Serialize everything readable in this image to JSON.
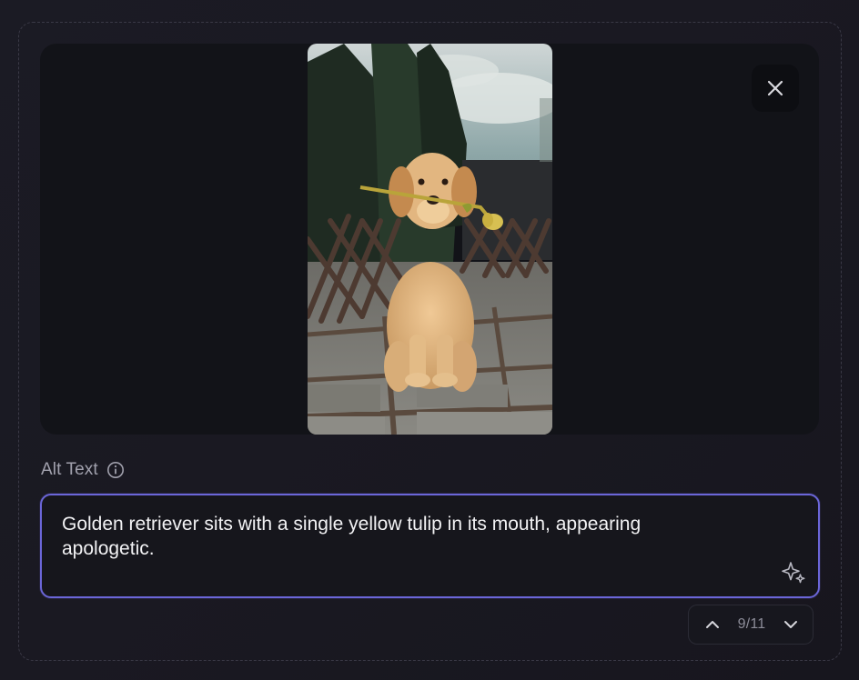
{
  "preview": {
    "image_alt": "Golden retriever puppy holding a yellow tulip in its mouth",
    "close_label": "Close"
  },
  "alt_text": {
    "label": "Alt Text",
    "value": "Golden retriever sits with a single yellow tulip in its mouth, appearing apologetic."
  },
  "pager": {
    "count": "9/11"
  },
  "icons": {
    "close": "close-icon",
    "info": "info-icon",
    "sparkle": "sparkle-icon",
    "prev": "chevron-up-icon",
    "next": "chevron-down-icon"
  },
  "colors": {
    "accent_border": "#6b66d8",
    "surface": "#16161c",
    "text_primary": "#f2f2f4",
    "text_muted": "#a1a1ad"
  }
}
